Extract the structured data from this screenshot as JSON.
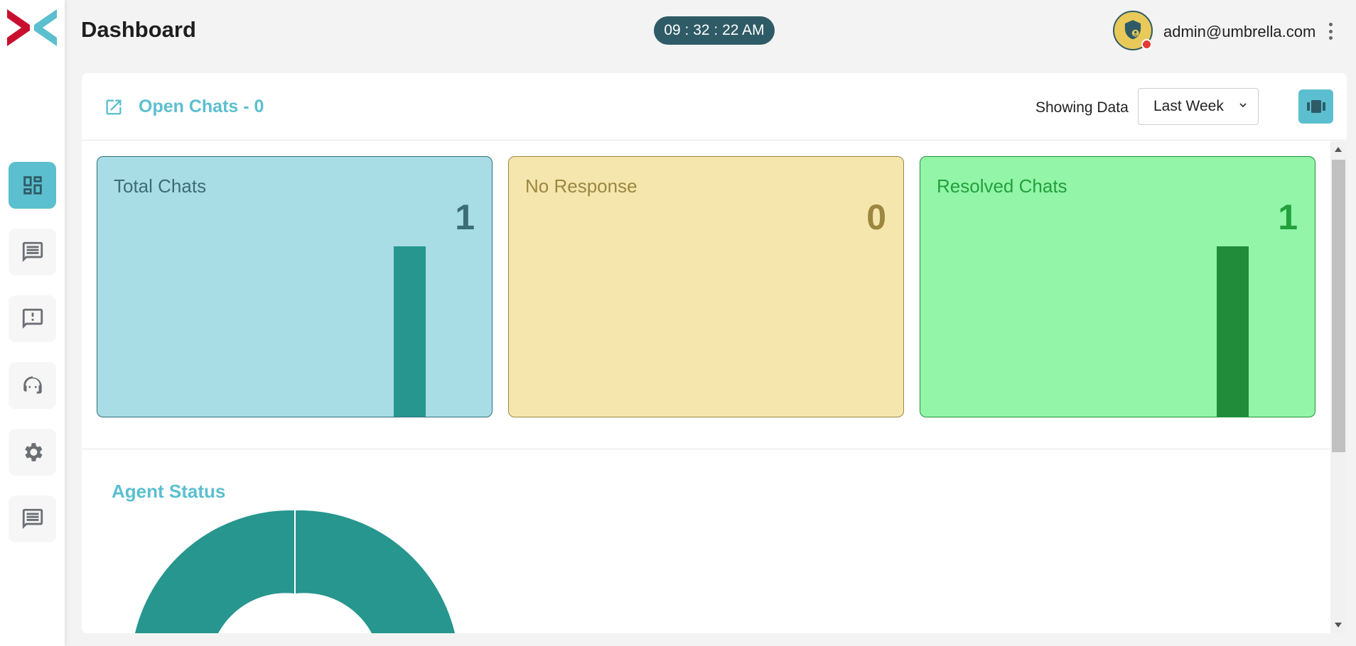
{
  "header": {
    "title": "Dashboard",
    "clock": "09 : 32 : 22 AM",
    "user_email": "admin@umbrella.com"
  },
  "sidebar": {
    "items": [
      {
        "name": "dashboard",
        "icon": "dashboard-icon",
        "active": true
      },
      {
        "name": "chats",
        "icon": "chat-icon",
        "active": false
      },
      {
        "name": "alerts",
        "icon": "feedback-icon",
        "active": false
      },
      {
        "name": "agents",
        "icon": "support-agent-icon",
        "active": false
      },
      {
        "name": "settings",
        "icon": "gear-icon",
        "active": false
      },
      {
        "name": "messages",
        "icon": "chat-icon",
        "active": false
      }
    ]
  },
  "panel": {
    "open_chats_label": "Open Chats - 0",
    "showing_label": "Showing Data",
    "range_value": "Last Week",
    "range_options": [
      "Last Week"
    ]
  },
  "cards": [
    {
      "title": "Total Chats",
      "value": "1",
      "bar_fill": 1.0
    },
    {
      "title": "No Response",
      "value": "0",
      "bar_fill": 0
    },
    {
      "title": "Resolved Chats",
      "value": "1",
      "bar_fill": 1.0
    }
  ],
  "agent_status": {
    "title": "Agent Status"
  },
  "colors": {
    "accent": "#5bbfcf",
    "clock_bg": "#2e5b66",
    "total": "#a9dde6",
    "no_response": "#f5e6ad",
    "resolved": "#92f5a8",
    "donut": "#26968e"
  }
}
